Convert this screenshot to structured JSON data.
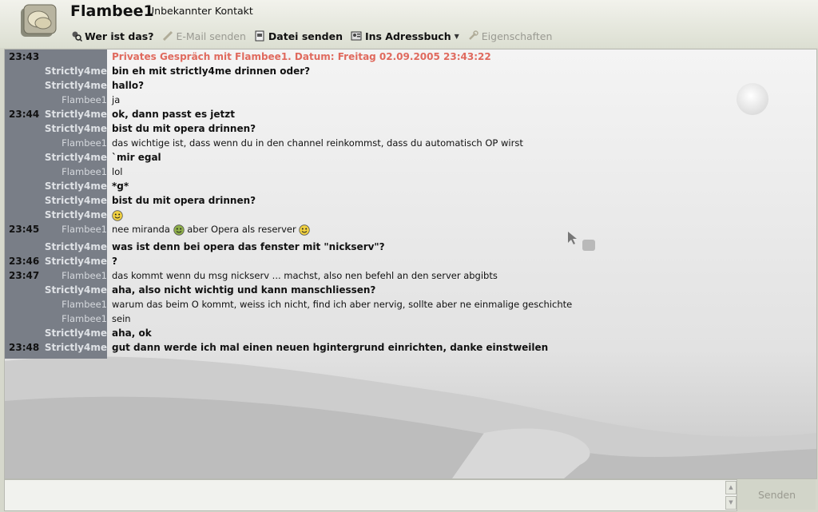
{
  "header": {
    "contact_name": "Flambee1",
    "contact_status": "Unbekannter Kontakt",
    "avatar_icon": "chat-bubbles-icon"
  },
  "toolbar": {
    "items": [
      {
        "label": "Wer ist das?",
        "icon": "user-search-icon",
        "enabled": true
      },
      {
        "label": "E-Mail senden",
        "icon": "pencil-icon",
        "enabled": false
      },
      {
        "label": "Datei senden",
        "icon": "document-icon",
        "enabled": true
      },
      {
        "label": "Ins Adressbuch",
        "icon": "address-book-icon",
        "enabled": true,
        "dropdown": true
      },
      {
        "label": "Eigenschaften",
        "icon": "wrench-icon",
        "enabled": false
      }
    ]
  },
  "chat": {
    "messages": [
      {
        "time": "23:43",
        "nick": "",
        "text": "Privates Gespräch mit Flambee1. Datum: Freitag 02.09.2005 23:43:22",
        "type": "system"
      },
      {
        "time": "",
        "nick": "Strictly4me",
        "text": "bin eh mit strictly4me drinnen oder?",
        "type": "own"
      },
      {
        "time": "",
        "nick": "Strictly4me",
        "text": "hallo?",
        "type": "own"
      },
      {
        "time": "",
        "nick": "Flambee1",
        "text": "ja",
        "type": "other"
      },
      {
        "time": "23:44",
        "nick": "Strictly4me",
        "text": "ok, dann passt es jetzt",
        "type": "own"
      },
      {
        "time": "",
        "nick": "Strictly4me",
        "text": "bist du mit opera drinnen?",
        "type": "own"
      },
      {
        "time": "",
        "nick": "Flambee1",
        "text": "das wichtige ist, dass wenn du in den channel reinkommst, dass du automatisch OP wirst",
        "type": "other"
      },
      {
        "time": "",
        "nick": "Strictly4me",
        "text": "`mir egal",
        "type": "own"
      },
      {
        "time": "",
        "nick": "Flambee1",
        "text": "lol",
        "type": "other"
      },
      {
        "time": "",
        "nick": "Strictly4me",
        "text": "*g*",
        "type": "own"
      },
      {
        "time": "",
        "nick": "Strictly4me",
        "text": "bist du mit opera drinnen?",
        "type": "own"
      },
      {
        "time": "",
        "nick": "Strictly4me",
        "text": "",
        "type": "own",
        "smiley": "grin-smiley-icon"
      },
      {
        "time": "23:45",
        "nick": "Flambee1",
        "text": "nee miranda",
        "text2": "aber Opera als reserver",
        "type": "other",
        "smiley": "green-smiley-icon",
        "smiley2": "grin-smiley-icon"
      },
      {
        "time": "",
        "nick": "Strictly4me",
        "text": "was ist denn bei opera das fenster mit \"nickserv\"?",
        "type": "own"
      },
      {
        "time": "23:46",
        "nick": "Strictly4me",
        "text": "?",
        "type": "own"
      },
      {
        "time": "23:47",
        "nick": "Flambee1",
        "text": "das kommt wenn du msg nickserv ... machst, also nen befehl an den server abgibts",
        "type": "other"
      },
      {
        "time": "",
        "nick": "Strictly4me",
        "text": "aha, also nicht wichtig und kann manschliessen?",
        "type": "own"
      },
      {
        "time": "",
        "nick": "Flambee1",
        "text": "warum das beim O kommt, weiss ich nicht, find ich aber nervig, sollte aber ne einmalige geschichte",
        "type": "other"
      },
      {
        "time": "",
        "nick": "Flambee1",
        "text": "sein",
        "type": "other"
      },
      {
        "time": "",
        "nick": "Strictly4me",
        "text": "aha, ok",
        "type": "own"
      },
      {
        "time": "23:48",
        "nick": "Strictly4me",
        "text": "gut dann werde ich mal einen neuen hgintergrund einrichten, danke einstweilen",
        "type": "own"
      }
    ]
  },
  "input": {
    "value": "",
    "send_label": "Senden"
  },
  "colors": {
    "system_text": "#e06a5e",
    "nick_column_bg": "#797e87"
  }
}
